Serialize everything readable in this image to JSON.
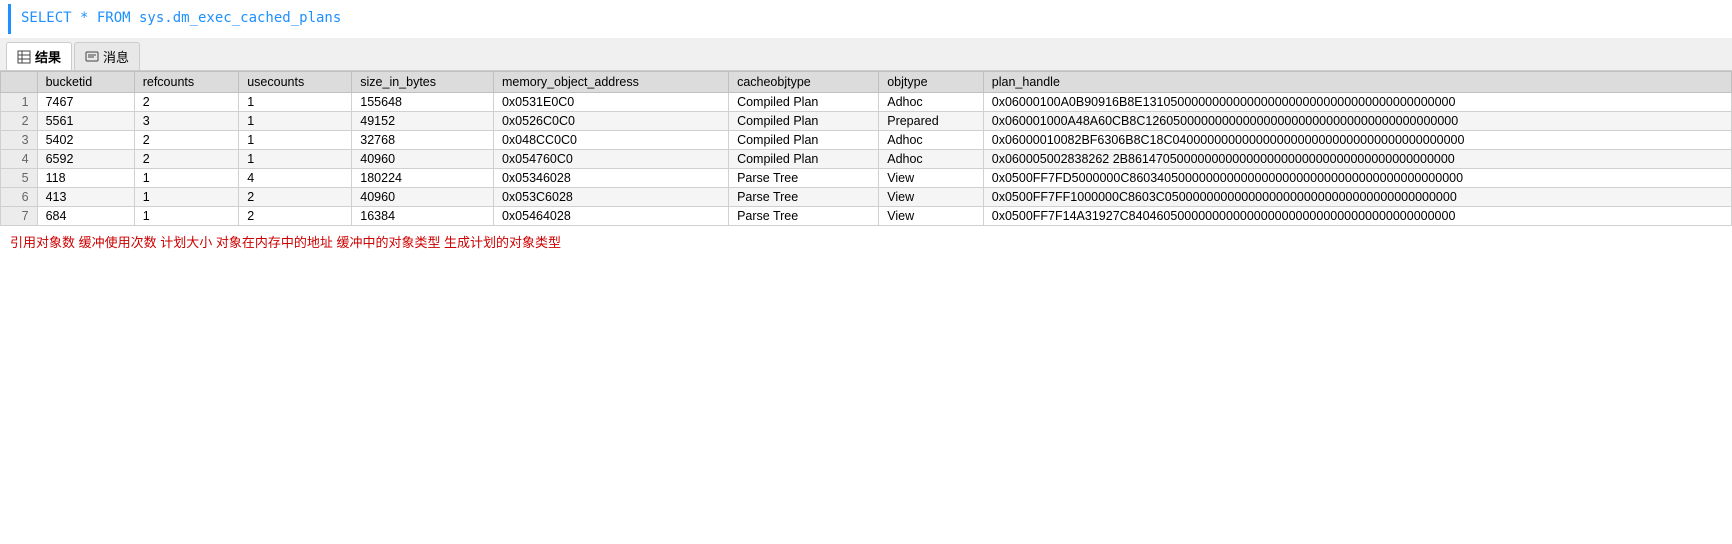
{
  "sql": {
    "query": "SELECT * FROM sys.dm_exec_cached_plans"
  },
  "tabs": [
    {
      "id": "results",
      "label": "结果",
      "active": true
    },
    {
      "id": "messages",
      "label": "消息",
      "active": false
    }
  ],
  "table": {
    "columns": [
      "",
      "bucketid",
      "refcounts",
      "usecounts",
      "size_in_bytes",
      "memory_object_address",
      "cacheobjtype",
      "objtype",
      "plan_handle"
    ],
    "rows": [
      {
        "num": "1",
        "bucketid": "7467",
        "refcounts": "2",
        "usecounts": "1",
        "size_in_bytes": "155648",
        "memory_object_address": "0x0531E0C0",
        "cacheobjtype": "Compiled Plan",
        "objtype": "Adhoc",
        "plan_handle": "0x06000100A0B90916B8E131050000000000000000000000000000000000000000",
        "highlight": true
      },
      {
        "num": "2",
        "bucketid": "5561",
        "refcounts": "3",
        "usecounts": "1",
        "size_in_bytes": "49152",
        "memory_object_address": "0x0526C0C0",
        "cacheobjtype": "Compiled Plan",
        "objtype": "Prepared",
        "plan_handle": "0x060001000A48A60CB8C126050000000000000000000000000000000000000000",
        "highlight": false
      },
      {
        "num": "3",
        "bucketid": "5402",
        "refcounts": "2",
        "usecounts": "1",
        "size_in_bytes": "32768",
        "memory_object_address": "0x048CC0C0",
        "cacheobjtype": "Compiled Plan",
        "objtype": "Adhoc",
        "plan_handle": "0x06000010082BF6306B8C18C040000000000000000000000000000000000000000",
        "highlight": false
      },
      {
        "num": "4",
        "bucketid": "6592",
        "refcounts": "2",
        "usecounts": "1",
        "size_in_bytes": "40960",
        "memory_object_address": "0x054760C0",
        "cacheobjtype": "Compiled Plan",
        "objtype": "Adhoc",
        "plan_handle": "0x060005002838262 2B86147050000000000000000000000000000000000000000",
        "highlight": false
      },
      {
        "num": "5",
        "bucketid": "118",
        "refcounts": "1",
        "usecounts": "4",
        "size_in_bytes": "180224",
        "memory_object_address": "0x05346028",
        "cacheobjtype": "Parse Tree",
        "objtype": "View",
        "plan_handle": "0x0500FF7FD5000000C860340500000000000000000000000000000000000000000",
        "highlight": false
      },
      {
        "num": "6",
        "bucketid": "413",
        "refcounts": "1",
        "usecounts": "2",
        "size_in_bytes": "40960",
        "memory_object_address": "0x053C6028",
        "cacheobjtype": "Parse Tree",
        "objtype": "View",
        "plan_handle": "0x0500FF7FF1000000C8603C050000000000000000000000000000000000000000",
        "highlight": false
      },
      {
        "num": "7",
        "bucketid": "684",
        "refcounts": "1",
        "usecounts": "2",
        "size_in_bytes": "16384",
        "memory_object_address": "0x05464028",
        "cacheobjtype": "Parse Tree",
        "objtype": "View",
        "plan_handle": "0x0500FF7F14A31927C84046050000000000000000000000000000000000000000",
        "highlight": false
      }
    ]
  },
  "annotations": {
    "text": "引用对象数  缓冲使用次数  计划大小        对象在内存中的地址  缓冲中的对象类型  生成计划的对象类型"
  }
}
